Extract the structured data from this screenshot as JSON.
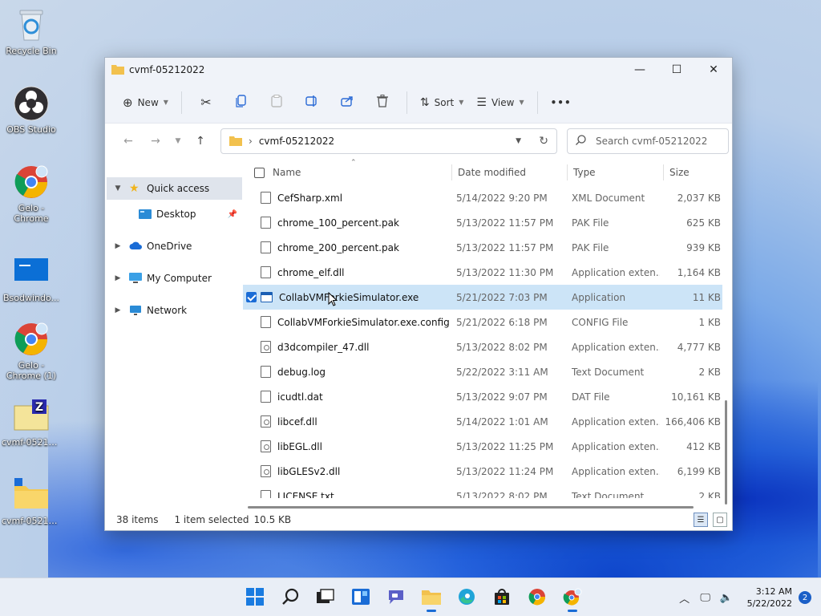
{
  "desktop": {
    "icons": [
      {
        "label": "Recycle Bin"
      },
      {
        "label": "OBS Studio"
      },
      {
        "label": "Gelo - Chrome"
      },
      {
        "label": "Bsodwindo..."
      },
      {
        "label": "Gelo - Chrome (1)"
      },
      {
        "label": "cvmf-05212..."
      },
      {
        "label": "cvmf-05212..."
      }
    ]
  },
  "window": {
    "title": "cvmf-05212022",
    "controls": {
      "minimize": "—",
      "maximize": "☐",
      "close": "✕"
    }
  },
  "toolbar": {
    "new_label": "New",
    "sort_label": "Sort",
    "view_label": "View",
    "more_label": "•••"
  },
  "address": {
    "path": "cvmf-05212022",
    "search_placeholder": "Search cvmf-05212022"
  },
  "nav": {
    "items": [
      {
        "label": "Quick access"
      },
      {
        "label": "Desktop"
      },
      {
        "label": "OneDrive"
      },
      {
        "label": "My Computer"
      },
      {
        "label": "Network"
      }
    ]
  },
  "columns": {
    "name": "Name",
    "date": "Date modified",
    "type": "Type",
    "size": "Size"
  },
  "files": [
    {
      "name": "CefSharp.xml",
      "date": "5/14/2022 9:20 PM",
      "type": "XML Document",
      "size": "2,037 KB"
    },
    {
      "name": "chrome_100_percent.pak",
      "date": "5/13/2022 11:57 PM",
      "type": "PAK File",
      "size": "625 KB"
    },
    {
      "name": "chrome_200_percent.pak",
      "date": "5/13/2022 11:57 PM",
      "type": "PAK File",
      "size": "939 KB"
    },
    {
      "name": "chrome_elf.dll",
      "date": "5/13/2022 11:30 PM",
      "type": "Application exten...",
      "size": "1,164 KB"
    },
    {
      "name": "CollabVMForkieSimulator.exe",
      "date": "5/21/2022 7:03 PM",
      "type": "Application",
      "size": "11 KB"
    },
    {
      "name": "CollabVMForkieSimulator.exe.config",
      "date": "5/21/2022 6:18 PM",
      "type": "CONFIG File",
      "size": "1 KB"
    },
    {
      "name": "d3dcompiler_47.dll",
      "date": "5/13/2022 8:02 PM",
      "type": "Application exten...",
      "size": "4,777 KB"
    },
    {
      "name": "debug.log",
      "date": "5/22/2022 3:11 AM",
      "type": "Text Document",
      "size": "2 KB"
    },
    {
      "name": "icudtl.dat",
      "date": "5/13/2022 9:07 PM",
      "type": "DAT File",
      "size": "10,161 KB"
    },
    {
      "name": "libcef.dll",
      "date": "5/14/2022 1:01 AM",
      "type": "Application exten...",
      "size": "166,406 KB"
    },
    {
      "name": "libEGL.dll",
      "date": "5/13/2022 11:25 PM",
      "type": "Application exten...",
      "size": "412 KB"
    },
    {
      "name": "libGLESv2.dll",
      "date": "5/13/2022 11:24 PM",
      "type": "Application exten...",
      "size": "6,199 KB"
    },
    {
      "name": "LICENSE.txt",
      "date": "5/13/2022 8:02 PM",
      "type": "Text Document",
      "size": "2 KB"
    }
  ],
  "status": {
    "items_count": "38 items",
    "selection": "1 item selected",
    "selection_size": "10.5 KB"
  },
  "taskbar": {
    "time": "3:12 AM",
    "date": "5/22/2022",
    "notifications": "2"
  },
  "colors": {
    "accent": "#1a6cd6",
    "selection": "#cce4f7",
    "folder": "#f2c14e"
  }
}
